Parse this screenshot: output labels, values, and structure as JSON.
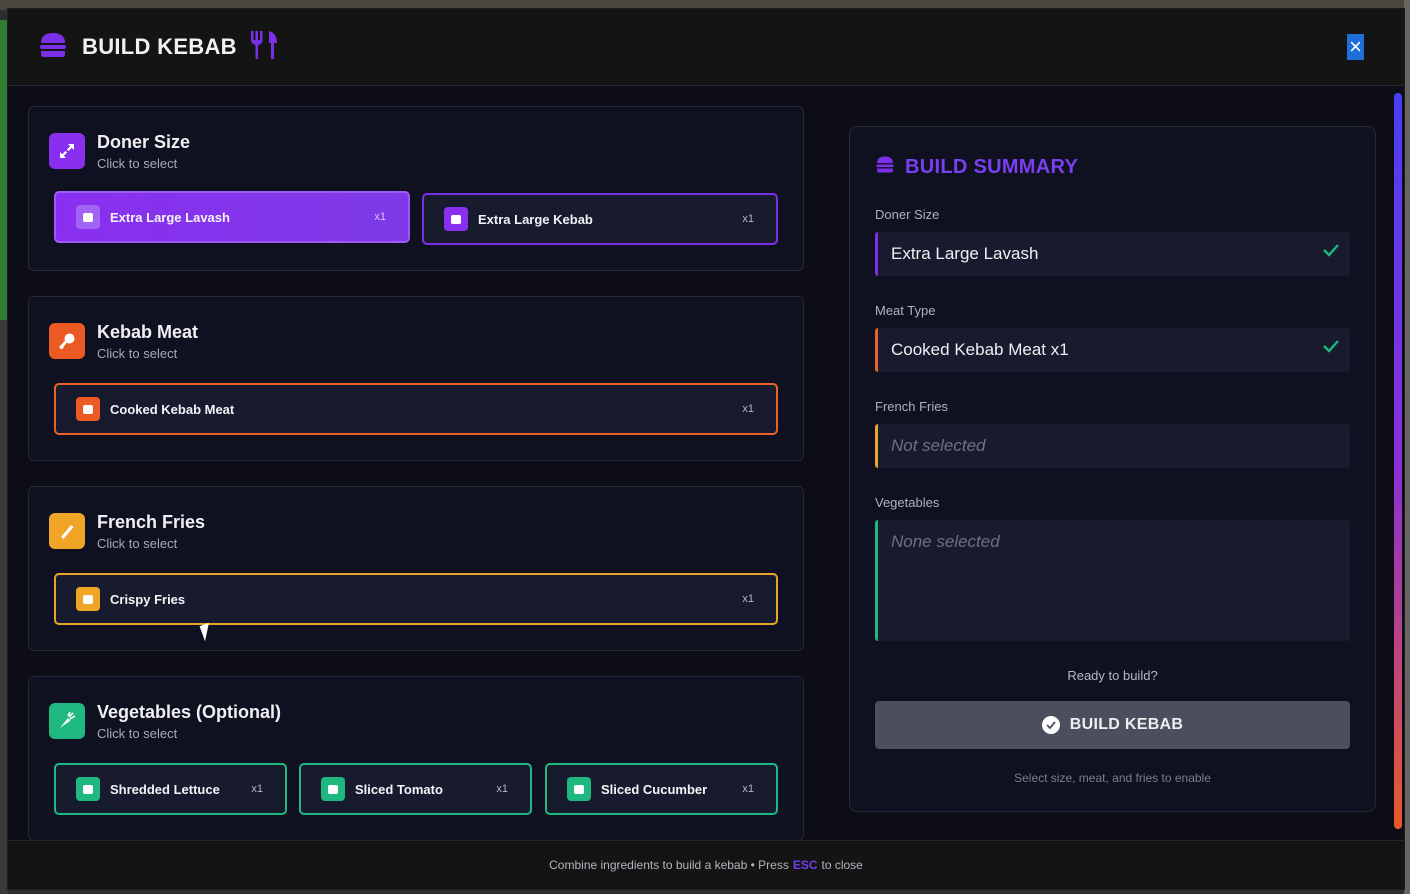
{
  "header": {
    "title": "BUILD KEBAB"
  },
  "sections": {
    "size": {
      "title": "Doner Size",
      "subtitle": "Click to select",
      "options": [
        {
          "label": "Extra Large Lavash",
          "qty": "x1",
          "selected": true
        },
        {
          "label": "Extra Large Kebab",
          "qty": "x1",
          "selected": false
        }
      ]
    },
    "meat": {
      "title": "Kebab Meat",
      "subtitle": "Click to select",
      "options": [
        {
          "label": "Cooked Kebab Meat",
          "qty": "x1"
        }
      ]
    },
    "fries": {
      "title": "French Fries",
      "subtitle": "Click to select",
      "options": [
        {
          "label": "Crispy Fries",
          "qty": "x1"
        }
      ]
    },
    "veg": {
      "title": "Vegetables (Optional)",
      "subtitle": "Click to select",
      "options": [
        {
          "label": "Shredded Lettuce",
          "qty": "x1"
        },
        {
          "label": "Sliced Tomato",
          "qty": "x1"
        },
        {
          "label": "Sliced Cucumber",
          "qty": "x1"
        }
      ]
    }
  },
  "summary": {
    "title": "BUILD SUMMARY",
    "size_label": "Doner Size",
    "size_value": "Extra Large Lavash",
    "meat_label": "Meat Type",
    "meat_value": "Cooked Kebab Meat x1",
    "fries_label": "French Fries",
    "fries_value": "Not selected",
    "veg_label": "Vegetables",
    "veg_value": "None selected",
    "ready": "Ready to build?",
    "build_button": "BUILD KEBAB",
    "hint": "Select size, meat, and fries to enable"
  },
  "footer": {
    "before": "Combine ingredients to build a kebab • Press",
    "key": "ESC",
    "after": "to close"
  },
  "colors": {
    "accent": "#7c2fe8",
    "meat": "#e8622a",
    "fries": "#e9a42a",
    "veg": "#1fb880"
  }
}
